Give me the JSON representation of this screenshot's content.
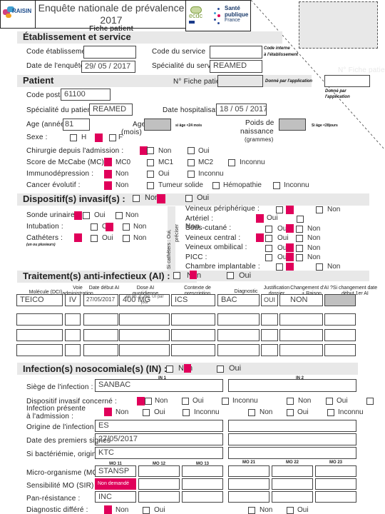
{
  "header": {
    "title_line1": "Enquête nationale de prévalence",
    "title_line2": "2017",
    "subtitle": "Fiche patient",
    "logo_left": "RAISIN",
    "logo_right_line1": "Santé",
    "logo_right_line2": "publique",
    "logo_right_line3": "France",
    "logo_mid": "ecdc",
    "ghost_label": "N° Fiche patien"
  },
  "etablissement": {
    "title": "Établissement et service",
    "code_etab_label": "Code établissement",
    "code_etab_value": "",
    "code_service_label": "Code du service",
    "code_service_value": "",
    "code_service_note_1": "Code interne",
    "code_service_note_2": "à l'établissement",
    "date_label": "Date de l'enquête",
    "date_value": "29/ 05 / 2017",
    "specialite_service_label": "Spécialité du service",
    "specialite_service_value": "REAMED"
  },
  "patient": {
    "title": "Patient",
    "fiche_label": "N° Fiche patient",
    "fiche_value": "",
    "fiche_note": "Donné par l'application",
    "fiche_note2_1": "Donné par",
    "fiche_note2_2": "l'application",
    "code_postal_label": "Code postal",
    "code_postal_value": "61100",
    "specialite_label": "Spécialité du patient",
    "specialite_value": "REAMED",
    "date_hosp_label": "Date hospitalisation",
    "date_hosp_value": "18 / 05 / 2017",
    "age_label": "Age (années)",
    "age_value": "81",
    "age_mois_label_1": "Age",
    "age_mois_label_2": "(mois)",
    "age_mois_note": "si âge <24 mois",
    "poids_label_1": "Poids de",
    "poids_label_2": "naissance",
    "poids_label_3": "(grammes)",
    "poids_note": "Si âge <28jours",
    "sexe_label": "Sexe :",
    "sexe_h": "H",
    "sexe_f": "F",
    "chirurgie_label": "Chirurgie depuis l'admission :",
    "chirurgie_options": [
      "Non",
      "Oui"
    ],
    "mccabe_label": "Score de McCabe (MC) :",
    "mccabe_options": [
      "MC0",
      "MC1",
      "MC2",
      "Inconnu"
    ],
    "immuno_label": "Immunodépression :",
    "immuno_options": [
      "Non",
      "Oui",
      "Inconnu"
    ],
    "cancer_label": "Cancer évolutif :",
    "cancer_options": [
      "Non",
      "Tumeur solide",
      "Hémopathie",
      "Inconnu"
    ]
  },
  "dispositifs": {
    "title": "Dispositif(s) invasif(s) :",
    "no_label": "Non",
    "oui_label": "Oui",
    "sonde_label": "Sonde urinaire",
    "intubation_label": "Intubation :",
    "catheters_label": "Cathéters :",
    "catheters_note": "(un ou plusieurs)",
    "vertical_note_1": "Si cathéters : Oui,",
    "vertical_note_2": "préciser",
    "opt_oui": "Oui",
    "opt_non": "Non",
    "right_items": [
      "Veineux périphérique :",
      "Artériel :",
      "Sous-cutané :",
      "Veineux central :",
      "Veineux ombilical :",
      "PICC :",
      "Chambre implantable :"
    ],
    "overlap_text": "Non"
  },
  "traitement": {
    "title": "Traitement(s) anti-infectieux (AI) :",
    "no_label": "Non",
    "oui_label": "Oui",
    "columns": [
      "Molécule (DCI)",
      "Voie administration",
      "Date début AI",
      "Dose AI quotidienne",
      "Contexte de prescription",
      "Diagnostic",
      "Justification dossier",
      "Changement d'AI ? + Raison",
      "Si changement date début 1er AI"
    ],
    "dose_unit_note": "en nb, g, mg, UI par jour",
    "rows": [
      [
        "TEICO",
        "IV",
        "27/05/2017",
        "400 MG",
        "ICS",
        "BAC",
        "OUI",
        "NON",
        ""
      ],
      [
        "",
        "",
        "",
        "",
        "",
        "",
        "",
        "",
        ""
      ],
      [
        "",
        "",
        "",
        "",
        "",
        "",
        "",
        "",
        ""
      ],
      [
        "",
        "",
        "",
        "",
        "",
        "",
        "",
        "",
        ""
      ]
    ]
  },
  "infection": {
    "title": "Infection(s) nosocomiale(s) (IN) :",
    "no_label": "Non",
    "oui_label": "Oui",
    "in1": "IN 1",
    "in2": "IN 2",
    "siege_label": "Siège de l'infection :",
    "siege_in1": "SANBAC",
    "siege_in2": "",
    "dispositif_label": "Dispositif invasif concerné :",
    "dispositif_options": [
      "Non",
      "Oui",
      "Inconnu"
    ],
    "presente_label_1": "Infection présente",
    "presente_label_2": "à l'admission :",
    "presente_options": [
      "Non",
      "Oui",
      "Inconnu"
    ],
    "origine_label": "Origine de l'infection :",
    "origine_in1": "ES",
    "origine_in2": "",
    "date_signes_label": "Date des premiers signes",
    "date_signes_in1": "27/05/2017",
    "date_signes_in2": "",
    "bacteriemie_label": "Si bactériémie, origine :",
    "bacteriemie_in1": "KTC",
    "bacteriemie_in2": "",
    "mo_headers": [
      "MO 11",
      "MO 12",
      "MO 13",
      "MO 21",
      "MO 22",
      "MO 23"
    ],
    "mo_label": "Micro-organisme (MO) :",
    "mo_values": [
      "STANSP",
      "",
      "",
      "",
      "",
      ""
    ],
    "sensibilite_label": "Sensibilité MO (SIR) :",
    "sensibilite_values": [
      "Non demandé",
      "",
      "",
      "",
      "",
      ""
    ],
    "panres_label": "Pan-résistance :",
    "panres_values": [
      "INC",
      "",
      "",
      "",
      "",
      ""
    ],
    "diag_label": "Diagnostic différé :",
    "diag_options": [
      "Non",
      "Oui"
    ]
  },
  "colors": {
    "accent": "#e0005a",
    "band": "#e8e8e8",
    "gray_box": "#c0c0c0"
  }
}
